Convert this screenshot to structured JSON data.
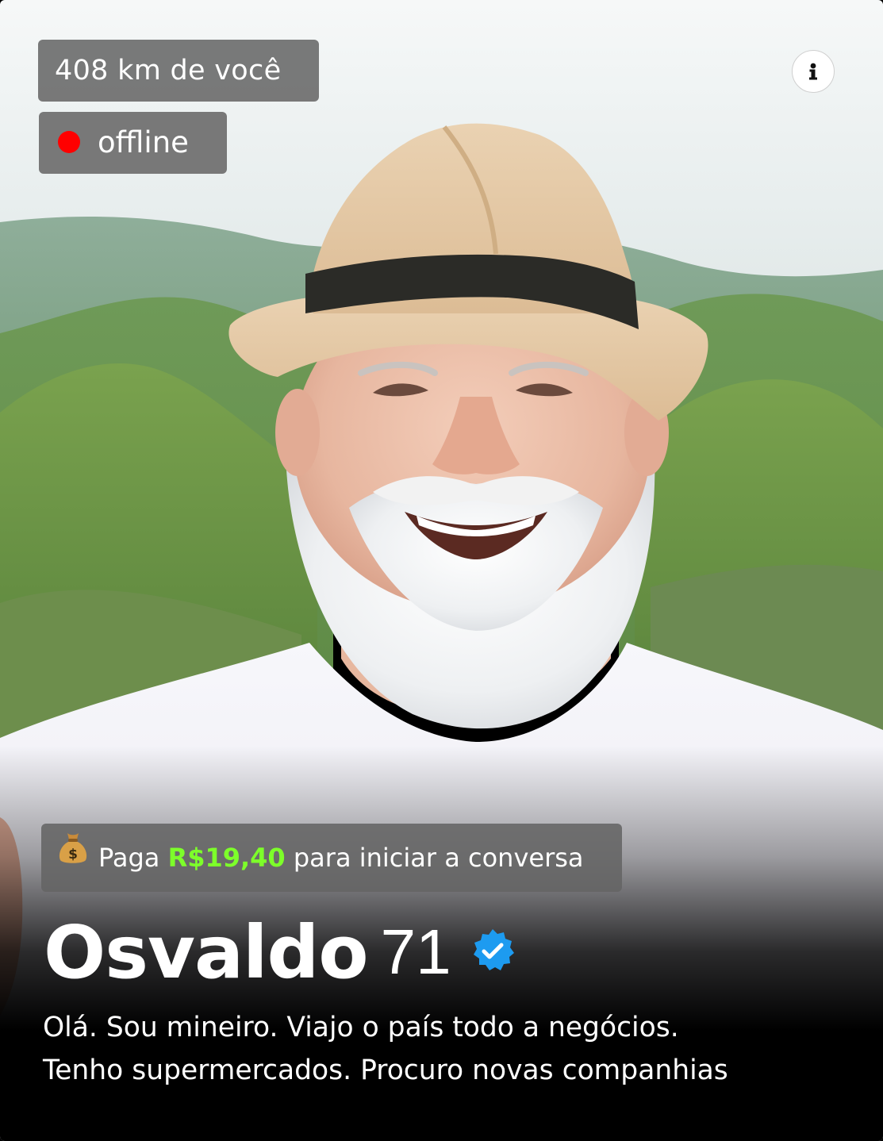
{
  "profile": {
    "distance": "408 km de você",
    "status": "offline",
    "status_color": "#ff0000",
    "pay_prefix": "Paga",
    "pay_price": "R$19,40",
    "pay_suffix": "para iniciar a conversa",
    "price_color": "#7dff2a",
    "name": "Osvaldo",
    "age": "71",
    "verified": true,
    "bio_line1": "Olá. Sou mineiro. Viajo o país todo a negócios.",
    "bio_line2": "Tenho supermercados. Procuro novas companhias"
  },
  "icons": {
    "info": "info-icon",
    "money_bag": "money-bag-icon",
    "verified": "verified-badge-icon"
  }
}
